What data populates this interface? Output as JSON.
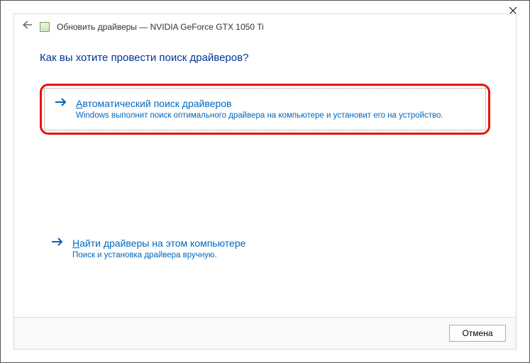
{
  "titlebar": {
    "close": "✕"
  },
  "header": {
    "title": "Обновить драйверы — NVIDIA GeForce GTX 1050 Ti"
  },
  "heading": "Как вы хотите провести поиск драйверов?",
  "options": [
    {
      "accel": "А",
      "title_rest": "втоматический поиск драйверов",
      "desc": "Windows выполнит поиск оптимального драйвера на компьютере и установит его на устройство."
    },
    {
      "accel": "Н",
      "title_rest": "айти драйверы на этом компьютере",
      "desc": "Поиск и установка драйвера вручную."
    }
  ],
  "footer": {
    "cancel": "Отмена"
  }
}
